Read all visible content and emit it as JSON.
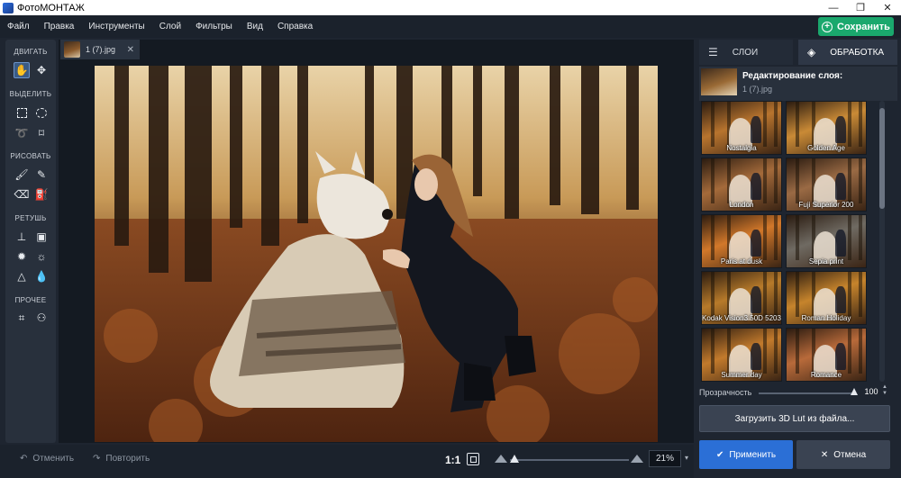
{
  "window": {
    "title": "ФотоМОНТАЖ",
    "minimize": "—",
    "maximize": "❐",
    "close": "✕"
  },
  "menu": [
    "Файл",
    "Правка",
    "Инструменты",
    "Слой",
    "Фильтры",
    "Вид",
    "Справка"
  ],
  "toolbar": {
    "save_label": "Сохранить"
  },
  "tools": {
    "move_heading": "ДВИГАТЬ",
    "select_heading": "ВЫДЕЛИТЬ",
    "draw_heading": "РИСОВАТЬ",
    "retouch_heading": "РЕТУШЬ",
    "other_heading": "ПРОЧЕЕ",
    "icons": {
      "move": [
        "hand-icon",
        "move-arrows-icon"
      ],
      "select": [
        "rect-select-icon",
        "ellipse-select-icon",
        "lasso-icon",
        "polygon-lasso-icon"
      ],
      "draw": [
        "brush-icon",
        "pencil-icon",
        "eraser-icon",
        "fill-bucket-icon"
      ],
      "retouch": [
        "stamp-icon",
        "patch-icon",
        "brighten-icon",
        "darken-icon",
        "sharpen-icon",
        "blur-drop-icon"
      ],
      "other": [
        "crop-icon",
        "shapes-icon"
      ]
    }
  },
  "document": {
    "tab_name": "1 (7).jpg",
    "close_symbol": "✕"
  },
  "bottom": {
    "undo_label": "Отменить",
    "redo_label": "Повторить",
    "ratio_label": "1:1",
    "zoom_value": "21%",
    "zoom_level": 0.0
  },
  "right_panel": {
    "tab_layers": "СЛОИ",
    "tab_processing": "ОБРАБОТКА",
    "layer_title": "Редактирование слоя:",
    "layer_file": "1 (7).jpg",
    "filters": [
      {
        "name": "Nostalgia",
        "color": "#b8742e"
      },
      {
        "name": "Golden Age",
        "color": "#c98a36"
      },
      {
        "name": "London",
        "color": "#a46a3a"
      },
      {
        "name": "Fuji Superior 200",
        "color": "#9a6a44"
      },
      {
        "name": "Paris at dusk",
        "color": "#d2782a"
      },
      {
        "name": "Sepia print",
        "color": "#6f6a62"
      },
      {
        "name": "Kodak Vision3 50D 5203",
        "color": "#b77a2a"
      },
      {
        "name": "Roman Holiday",
        "color": "#c6842c"
      },
      {
        "name": "Summer day",
        "color": "#c27a2c"
      },
      {
        "name": "Romance",
        "color": "#b86a3a"
      }
    ],
    "opacity_label": "Прозрачность",
    "opacity_value": "100",
    "lut_button": "Загрузить 3D Lut из файла...",
    "apply_button": "Применить",
    "cancel_button": "Отмена"
  },
  "colors": {
    "accent_green": "#1aa86d",
    "accent_blue": "#2b6fd6",
    "background": "#1e2530"
  }
}
